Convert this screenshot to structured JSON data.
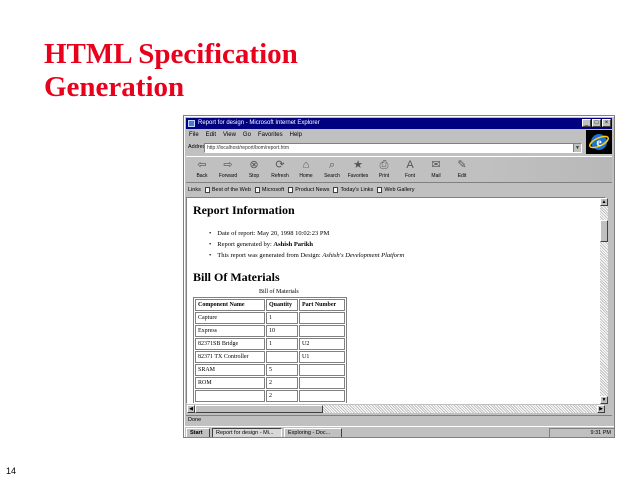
{
  "slide": {
    "title_line1": "HTML Specification",
    "title_line2": "Generation",
    "page_number": "14"
  },
  "window": {
    "title": "Report for design - Microsoft Internet Explorer",
    "controls": [
      "_",
      "□",
      "×"
    ],
    "menu": [
      "File",
      "Edit",
      "View",
      "Go",
      "Favorites",
      "Help"
    ],
    "address_label": "Address",
    "address_value": "http://localhost/report/bom/report.htm",
    "toolbar": [
      {
        "label": "Back",
        "icon": "back-arrow-icon",
        "glyph": "⇦"
      },
      {
        "label": "Forward",
        "icon": "forward-arrow-icon",
        "glyph": "⇨"
      },
      {
        "label": "Stop",
        "icon": "stop-icon",
        "glyph": "⊗"
      },
      {
        "label": "Refresh",
        "icon": "refresh-icon",
        "glyph": "⟳"
      },
      {
        "label": "Home",
        "icon": "home-icon",
        "glyph": "⌂"
      },
      {
        "label": "Search",
        "icon": "search-icon",
        "glyph": "⌕"
      },
      {
        "label": "Favorites",
        "icon": "favorites-icon",
        "glyph": "★"
      },
      {
        "label": "Print",
        "icon": "print-icon",
        "glyph": "⎙"
      },
      {
        "label": "Font",
        "icon": "font-icon",
        "glyph": "A"
      },
      {
        "label": "Mail",
        "icon": "mail-icon",
        "glyph": "✉"
      },
      {
        "label": "Edit",
        "icon": "edit-icon",
        "glyph": "✎"
      }
    ],
    "links_label": "Links",
    "links": [
      "Best of the Web",
      "Microsoft",
      "Product News",
      "Today's Links",
      "Web Gallery"
    ],
    "status": "Done"
  },
  "page": {
    "report_heading": "Report Information",
    "report_items": [
      {
        "prefix": "Date of report: ",
        "value": "May 20, 1998 10:02:23 PM",
        "style": "normal"
      },
      {
        "prefix": "Report generated by: ",
        "value": "Ashish Parikh",
        "style": "bold"
      },
      {
        "prefix": "This report was generated from Design: ",
        "value": "Ashish's Development Platform",
        "style": "italic"
      }
    ],
    "bom_heading": "Bill Of Materials",
    "bom_caption": "Bill of Materials",
    "bom_columns": [
      "Component Name",
      "Quantity",
      "Part Number"
    ],
    "bom_rows": [
      [
        "Capture",
        "1",
        ""
      ],
      [
        "Express",
        "10",
        ""
      ],
      [
        "82371SB Bridge",
        "1",
        "U2"
      ],
      [
        "82371 TX Controller",
        "",
        "U1"
      ],
      [
        "SRAM",
        "5",
        ""
      ],
      [
        "ROM",
        "2",
        ""
      ],
      [
        "",
        "2",
        ""
      ]
    ]
  },
  "taskbar": {
    "start": "Start",
    "tasks": [
      "Report for design - Mi...",
      "Exploring - Doc..."
    ],
    "clock": "9:31 PM"
  }
}
